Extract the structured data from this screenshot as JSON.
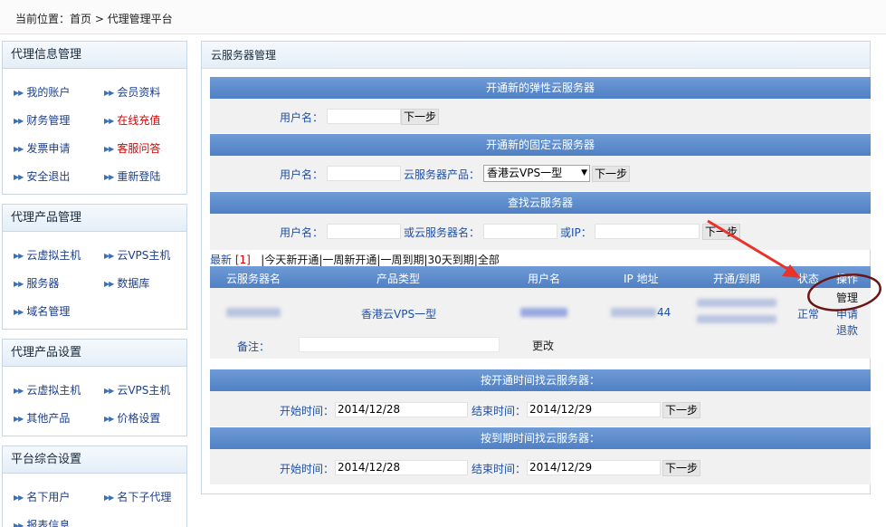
{
  "breadcrumb": "当前位置：首页 > 代理管理平台",
  "sidebar": {
    "sections": [
      {
        "title": "代理信息管理",
        "items": [
          {
            "label": "我的账户"
          },
          {
            "label": "会员资料"
          },
          {
            "label": "财务管理"
          },
          {
            "label": "在线充值"
          },
          {
            "label": "发票申请"
          },
          {
            "label": "客服问答"
          },
          {
            "label": "安全退出"
          },
          {
            "label": "重新登陆"
          }
        ]
      },
      {
        "title": "代理产品管理",
        "items": [
          {
            "label": "云虚拟主机"
          },
          {
            "label": "云VPS主机"
          },
          {
            "label": "服务器"
          },
          {
            "label": "数据库"
          },
          {
            "label": "域名管理"
          }
        ]
      },
      {
        "title": "代理产品设置",
        "items": [
          {
            "label": "云虚拟主机"
          },
          {
            "label": "云VPS主机"
          },
          {
            "label": "其他产品"
          },
          {
            "label": "价格设置"
          }
        ]
      },
      {
        "title": "平台综合设置",
        "items": [
          {
            "label": "名下用户"
          },
          {
            "label": "名下子代理"
          },
          {
            "label": "报表信息"
          }
        ]
      }
    ],
    "accent_red": "#d40000"
  },
  "main": {
    "title": "云服务器管理",
    "elastic": {
      "header": "开通新的弹性云服务器",
      "user_label": "用户名：",
      "next": "下一步"
    },
    "fixed": {
      "header": "开通新的固定云服务器",
      "user_label": "用户名：",
      "product_label": "云服务器产品：",
      "product_selected": "香港云VPS一型",
      "next": "下一步"
    },
    "search": {
      "header": "查找云服务器",
      "user_label": "用户名：",
      "name_label": "或云服务器名：",
      "ip_label": "或IP：",
      "next": "下一步"
    },
    "filters": {
      "newest": "最新",
      "count": "[1]",
      "items": [
        "今天新开通",
        "一周新开通",
        "一周到期",
        "30天到期",
        "全部"
      ]
    },
    "table": {
      "headers": [
        "云服务器名",
        "产品类型",
        "用户名",
        "IP 地址",
        "开通/到期",
        "状态",
        "操作"
      ],
      "row": {
        "product": "香港云VPS一型",
        "ip_suffix": "44",
        "status": "正常",
        "ops": [
          "管理",
          "申请",
          "退款"
        ],
        "note_label": "备注：",
        "change": "更改"
      }
    },
    "by_open": {
      "header": "按开通时间找云服务器：",
      "start_label": "开始时间：",
      "start": "2014/12/28",
      "end_label": "结束时间：",
      "end": "2014/12/29",
      "next": "下一步"
    },
    "by_expire": {
      "header": "按到期时间找云服务器：",
      "start_label": "开始时间：",
      "start": "2014/12/28",
      "end_label": "结束时间：",
      "end": "2014/12/29",
      "next": "下一步"
    }
  },
  "colors": {
    "header_blue": "#5a8bcb",
    "link_blue": "#1f4fa6",
    "annotation_red": "#e8332a",
    "circle_dark_red": "#6b1414"
  }
}
